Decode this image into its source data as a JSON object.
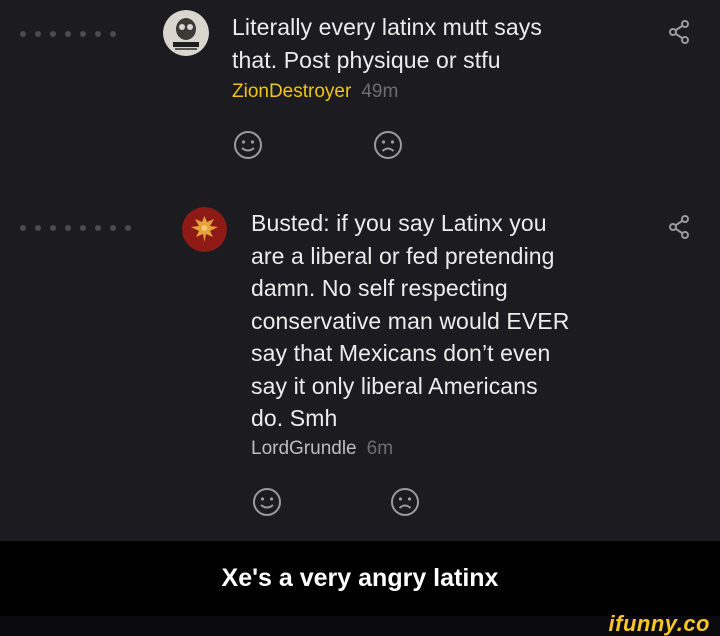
{
  "comments": [
    {
      "avatar_icon": "skull-avatar-icon",
      "lines": [
        "Literally every latinx mutt says",
        "that. Post physique or stfu"
      ],
      "username": "ZionDestroyer",
      "time": "49m",
      "username_color": "#f0c419"
    },
    {
      "avatar_icon": "eagle-avatar-icon",
      "lines": [
        "Busted: if you say Latinx you",
        "are a liberal or fed pretending",
        "damn. No self respecting",
        "conservative man would EVER",
        "say that Mexicans don’t even",
        "say it only liberal Americans",
        "do. Smh"
      ],
      "username": "LordGrundle",
      "time": "6m",
      "username_color": "#bdbdbd"
    }
  ],
  "caption": "Xe's a very angry latinx",
  "watermark": "ifunny.co",
  "colors": {
    "background": "#1c1c20",
    "text": "#ececec",
    "time": "#6e6e72",
    "caption_bar": "#000000",
    "watermark": "#f7c625"
  }
}
